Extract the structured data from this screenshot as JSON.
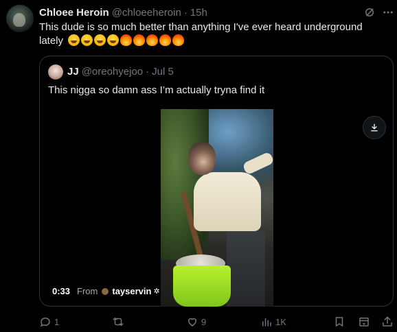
{
  "tweet": {
    "author_name": "Chloee Heroin",
    "handle": "@chloeeheroin",
    "separator": "·",
    "time": "15h",
    "text": "This dude is so much better than anything I've ever heard underground lately",
    "emojis": [
      "face-with-tears-of-joy",
      "face-with-tears-of-joy",
      "face-with-tears-of-joy",
      "face-with-tears-of-joy",
      "fire",
      "fire",
      "fire",
      "fire",
      "fire"
    ]
  },
  "quote": {
    "author_name": "JJ",
    "handle": "@oreohyejoo",
    "separator": "·",
    "time": "Jul 5",
    "text": "This nigga so damn ass I’m actually tryna find it",
    "video": {
      "duration": "0:33",
      "from_label": "From",
      "from_user": "tayservin",
      "download_icon": "download-icon"
    }
  },
  "actions": {
    "replies": "1",
    "reposts": "",
    "likes": "9",
    "views": "1K"
  },
  "colors": {
    "background": "#000000",
    "text": "#e7e9ea",
    "muted": "#71767b",
    "border": "#2f3336"
  }
}
